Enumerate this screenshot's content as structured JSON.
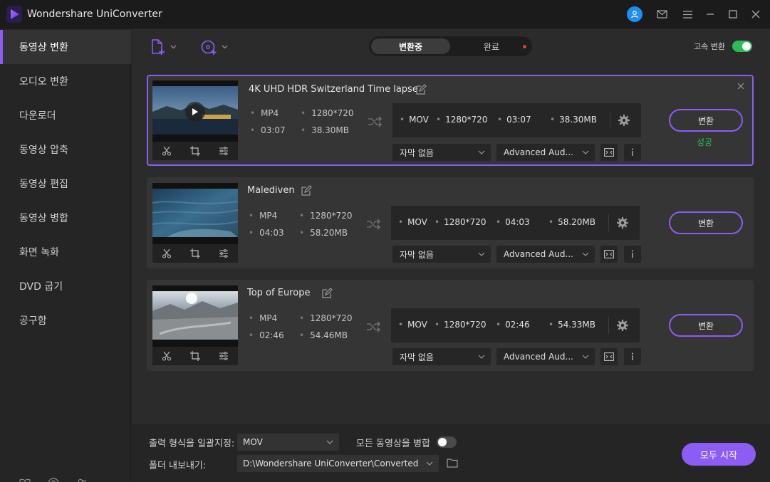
{
  "app": {
    "title": "Wondershare UniConverter",
    "accent": "#8c5cf5",
    "success_color": "#2dbb55"
  },
  "titlebar_icons": [
    "user-icon",
    "mail-icon",
    "menu-icon",
    "minimize-icon",
    "maximize-icon",
    "close-icon"
  ],
  "sidebar": {
    "items": [
      {
        "label": "동영상 변환",
        "active": true
      },
      {
        "label": "오디오 변환"
      },
      {
        "label": "다운로더"
      },
      {
        "label": "동영상 압축"
      },
      {
        "label": "동영상 편집"
      },
      {
        "label": "동영상 병합"
      },
      {
        "label": "화면 녹화"
      },
      {
        "label": "DVD 굽기"
      },
      {
        "label": "공구함"
      }
    ],
    "bottom_icons": [
      "book-icon",
      "help-icon",
      "account-icon"
    ]
  },
  "toolbar": {
    "tabs": [
      {
        "label": "변환중",
        "active": true
      },
      {
        "label": "완료"
      }
    ],
    "speed_label": "고속 변환",
    "speed_on": true
  },
  "files": [
    {
      "title": "4K UHD HDR Switzerland Time lapse",
      "src_format": "MP4",
      "src_res": "1280*720",
      "src_duration": "03:07",
      "src_size": "38.30MB",
      "out_format": "MOV",
      "out_res": "1280*720",
      "out_duration": "03:07",
      "out_size": "38.30MB",
      "subtitle": "자막 없음",
      "audio": "Advanced Aud...",
      "convert_label": "변환",
      "status": "성공",
      "selected": true
    },
    {
      "title": "Malediven",
      "src_format": "MP4",
      "src_res": "1280*720",
      "src_duration": "04:03",
      "src_size": "58.20MB",
      "out_format": "MOV",
      "out_res": "1280*720",
      "out_duration": "04:03",
      "out_size": "58.20MB",
      "subtitle": "자막 없음",
      "audio": "Advanced Aud...",
      "convert_label": "변환"
    },
    {
      "title": "Top of Europe",
      "src_format": "MP4",
      "src_res": "1280*720",
      "src_duration": "02:46",
      "src_size": "54.46MB",
      "out_format": "MOV",
      "out_res": "1280*720",
      "out_duration": "02:46",
      "out_size": "54.33MB",
      "subtitle": "자막 없음",
      "audio": "Advanced Aud...",
      "convert_label": "변환"
    }
  ],
  "footer": {
    "format_label": "출력 형식을 일괄지정:",
    "format_value": "MOV",
    "merge_label": "모든 동영상을 병합",
    "merge_on": false,
    "folder_label": "폴더 내보내기:",
    "folder_path": "D:\\Wondershare UniConverter\\Converted",
    "start_label": "모두 시작"
  }
}
